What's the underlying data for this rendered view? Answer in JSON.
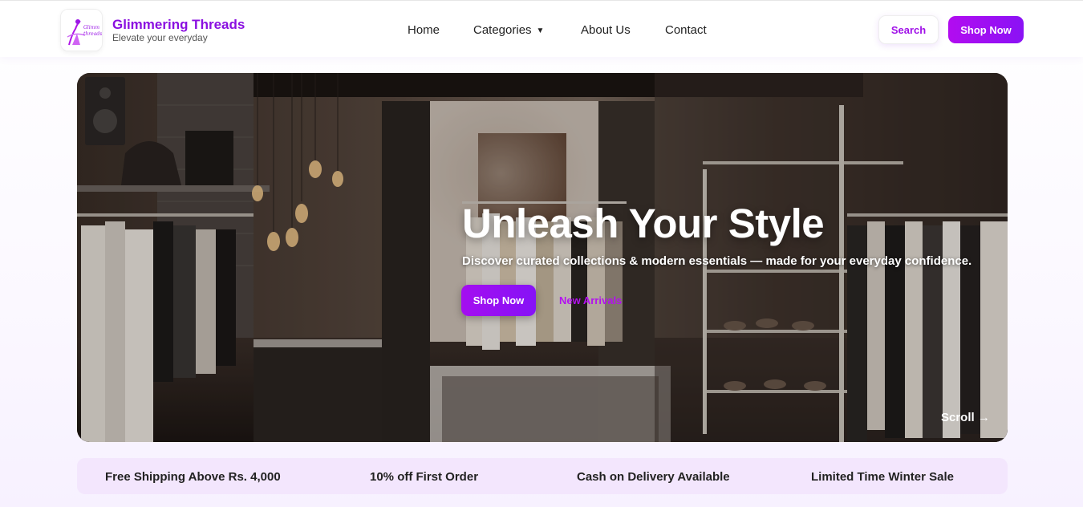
{
  "brand": {
    "name": "Glimmering Threads",
    "tagline": "Elevate your everyday",
    "logo_text": "Glimmering threads"
  },
  "nav": {
    "home": "Home",
    "categories": "Categories",
    "about": "About Us",
    "contact": "Contact"
  },
  "header_actions": {
    "search": "Search",
    "shop_now": "Shop Now"
  },
  "hero": {
    "title": "Unleash Your Style",
    "subtitle": "Discover curated collections & modern essentials — made for your everyday confidence.",
    "primary_button": "Shop Now",
    "secondary_link": "New Arrivals",
    "scroll": "Scroll →"
  },
  "promos": [
    "Free Shipping Above Rs. 4,000",
    "10% off First Order",
    "Cash on Delivery Available",
    "Limited Time Winter Sale"
  ],
  "colors": {
    "accent": "#8a0fe0",
    "button_gradient_start": "#b20cf0",
    "button_gradient_end": "#8a12f5",
    "promo_bg": "#f3e6fd"
  }
}
